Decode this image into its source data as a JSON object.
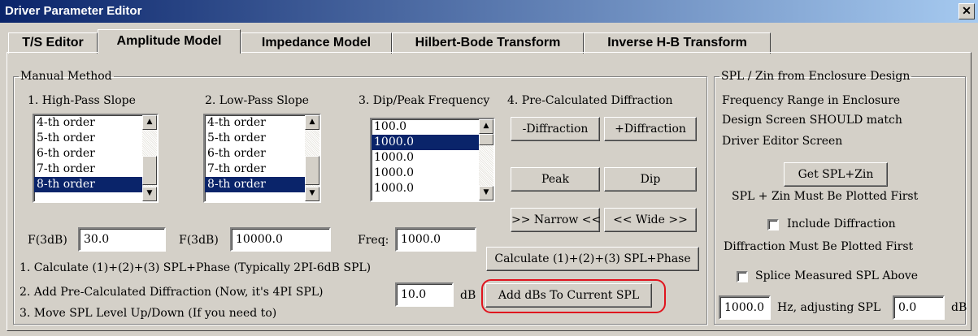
{
  "window": {
    "title": "Driver Parameter Editor",
    "close_glyph": "✕"
  },
  "tabs": [
    {
      "label": "T/S Editor"
    },
    {
      "label": "Amplitude Model"
    },
    {
      "label": "Impedance Model"
    },
    {
      "label": "Hilbert-Bode Transform"
    },
    {
      "label": "Inverse H-B Transform"
    }
  ],
  "manual": {
    "legend": "Manual Method",
    "col1": {
      "header": "1. High-Pass Slope",
      "items": [
        "4-th order",
        "5-th order",
        "6-th order",
        "7-th order",
        "8-th order"
      ],
      "f_label": "F(3dB)",
      "f_value": "30.0"
    },
    "col2": {
      "header": "2. Low-Pass Slope",
      "items": [
        "4-th order",
        "5-th order",
        "6-th order",
        "7-th order",
        "8-th order"
      ],
      "f_label": "F(3dB)",
      "f_value": "10000.0"
    },
    "col3": {
      "header": "3. Dip/Peak Frequency",
      "items": [
        "100.0",
        "1000.0",
        "1000.0",
        "1000.0",
        "1000.0"
      ],
      "freq_label": "Freq:",
      "freq_value": "1000.0"
    },
    "col4": {
      "header": "4. Pre-Calculated Diffraction",
      "minus_diffraction": "-Diffraction",
      "plus_diffraction": "+Diffraction",
      "peak": "Peak",
      "dip": "Dip",
      "narrow": ">> Narrow <<",
      "wide": "<< Wide >>",
      "calculate": "Calculate (1)+(2)+(3) SPL+Phase"
    },
    "notes": [
      "1. Calculate (1)+(2)+(3) SPL+Phase (Typically 2PI-6dB SPL)",
      "2. Add Pre-Calculated Diffraction (Now, it's 4PI SPL)",
      "3. Move SPL Level Up/Down (If you need to)"
    ],
    "db_value": "10.0",
    "db_unit": "dB",
    "add_dbs": "Add dBs To Current SPL"
  },
  "enclosure": {
    "legend": "SPL / Zin from Enclosure Design",
    "info": [
      "Frequency Range in Enclosure",
      "Design Screen SHOULD match",
      "Driver Editor Screen"
    ],
    "get_spl": "Get SPL+Zin",
    "must_plot": "SPL + Zin Must Be Plotted First",
    "include_diffraction": "Include Diffraction",
    "diffraction_must": "Diffraction Must Be Plotted First",
    "splice_label": "Splice Measured SPL Above",
    "splice_hz_value": "1000.0",
    "hz_label": "Hz, adjusting SPL",
    "adjust_value": "0.0",
    "db_unit": "dB"
  },
  "colors": {
    "accent": "#0a246a",
    "face": "#d4d0c8",
    "highlight": "#e0141e"
  }
}
